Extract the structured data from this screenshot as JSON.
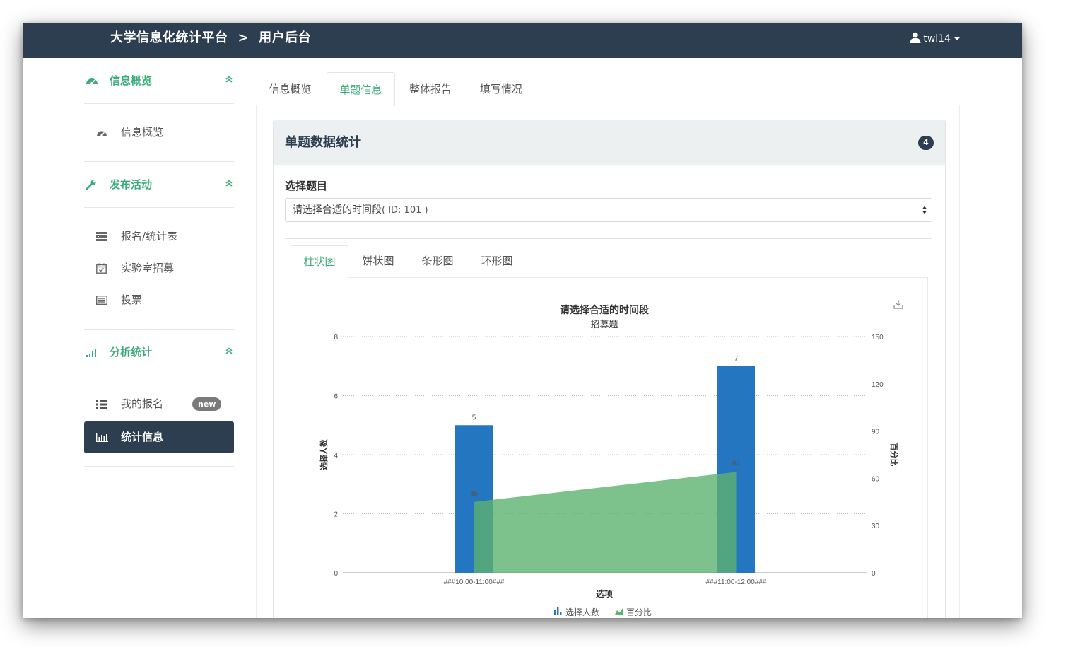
{
  "navbar": {
    "site_title": "大学信息化统计平台",
    "separator": ">",
    "section_title": "用户后台",
    "user_name": "twl14"
  },
  "sidebar": {
    "groups": [
      {
        "title": "信息概览",
        "icon": "dashboard-icon",
        "items": [
          {
            "label": "信息概览",
            "icon": "dashboard-icon"
          }
        ]
      },
      {
        "title": "发布活动",
        "icon": "wrench-icon",
        "items": [
          {
            "label": "报名/统计表",
            "icon": "list-form-icon"
          },
          {
            "label": "实验室招募",
            "icon": "calendar-check-icon"
          },
          {
            "label": "投票",
            "icon": "ballot-icon"
          }
        ]
      },
      {
        "title": "分析统计",
        "icon": "signal-bars-icon",
        "items": [
          {
            "label": "我的报名",
            "icon": "list-icon",
            "badge": "new"
          },
          {
            "label": "统计信息",
            "icon": "bar-chart-icon",
            "active": true
          }
        ]
      }
    ]
  },
  "tabs": [
    {
      "label": "信息概览"
    },
    {
      "label": "单题信息",
      "active": true
    },
    {
      "label": "整体报告"
    },
    {
      "label": "填写情况"
    }
  ],
  "panel": {
    "title": "单题数据统计",
    "count": "4",
    "select_label": "选择题目",
    "selected_question": "请选择合适的时间段",
    "selected_question_id": "( ID: 101 )"
  },
  "chart_tabs": [
    {
      "label": "柱状图",
      "active": true
    },
    {
      "label": "饼状图"
    },
    {
      "label": "条形图"
    },
    {
      "label": "环形图"
    }
  ],
  "chart_data": {
    "type": "bar",
    "title": "请选择合适的时间段",
    "subtitle": "招募题",
    "xlabel": "选项",
    "ylabel": "选择人数",
    "y2label": "百分比",
    "categories": [
      "###10:00-11:00###",
      "###11:00-12:00###"
    ],
    "series": [
      {
        "name": "选择人数",
        "kind": "bar",
        "axis": "left",
        "values": [
          5,
          7
        ],
        "color": "#2476c1"
      },
      {
        "name": "百分比",
        "kind": "area",
        "axis": "right",
        "values": [
          45,
          64
        ],
        "color": "#5cb370"
      }
    ],
    "ylim": [
      0,
      8
    ],
    "yticks": [
      0,
      2,
      4,
      6,
      8
    ],
    "y2lim": [
      0,
      150
    ],
    "y2ticks": [
      0,
      30,
      60,
      90,
      120,
      150
    ],
    "grid": true,
    "legend_position": "bottom"
  }
}
